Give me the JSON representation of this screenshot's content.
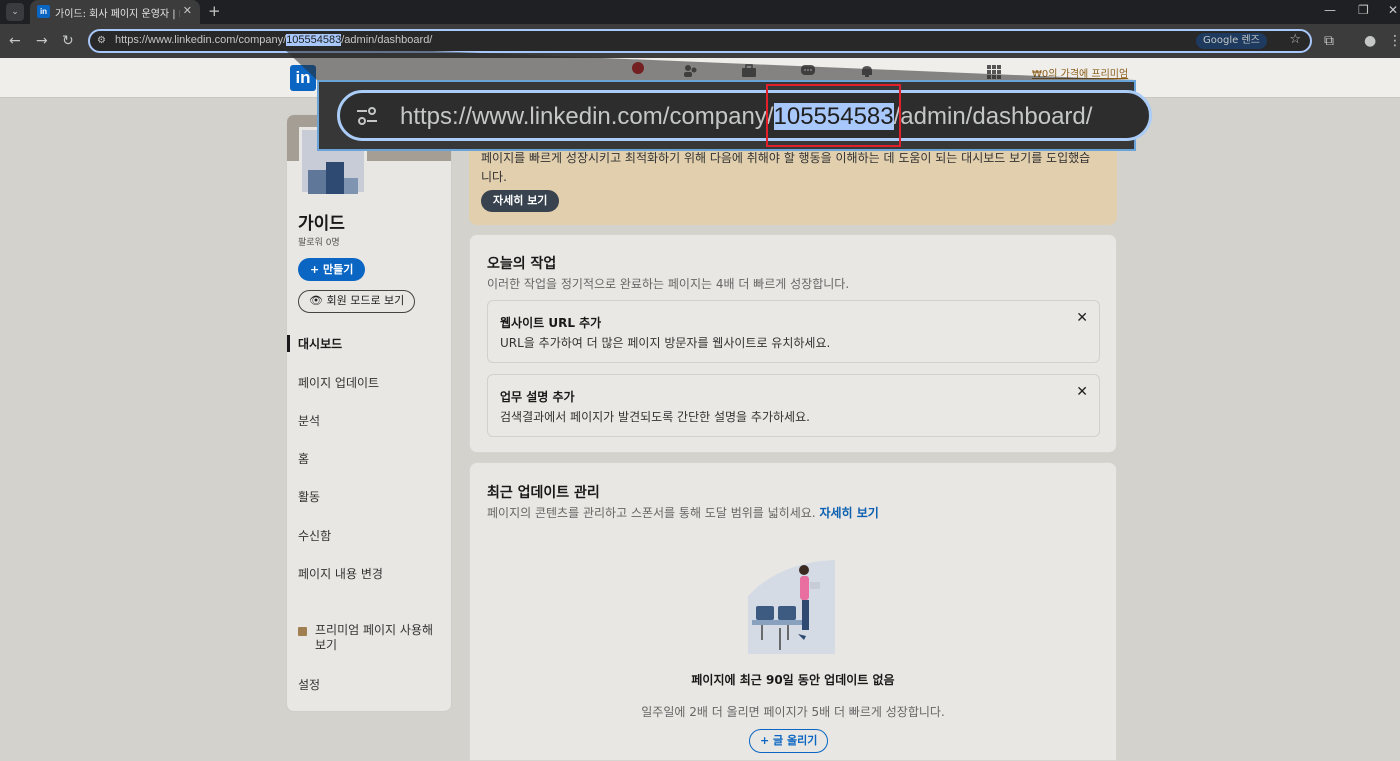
{
  "browser": {
    "tab_title": "가이드: 회사 페이지 운영자 | L",
    "tab_favicon": "in",
    "url_prefix": "https://www.linkedin.com/company/",
    "url_id": "105554583",
    "url_suffix": "/admin/dashboard/",
    "lens_label": "Google 렌즈"
  },
  "zoom": {
    "url_prefix": "https://www.linkedin.com/company/",
    "url_id": "105554583",
    "url_suffix": "/admin/dashboard/"
  },
  "header": {
    "logo": "in",
    "premium_link": "₩0의 가격에 프리미엄"
  },
  "sidebar": {
    "company_name": "가이드",
    "followers": "팔로워 0명",
    "create_button": "+ 만들기",
    "member_view_button": "회원 모드로 보기",
    "nav": [
      {
        "label": "대시보드"
      },
      {
        "label": "페이지 업데이트"
      },
      {
        "label": "분석"
      },
      {
        "label": "홈"
      },
      {
        "label": "활동"
      },
      {
        "label": "수신함"
      },
      {
        "label": "페이지 내용 변경"
      }
    ],
    "premium_item": "프리미엄 페이지 사용해 보기",
    "settings": "설정"
  },
  "banner": {
    "text": "페이지를 빠르게 성장시키고 최적화하기 위해 다음에 취해야 할 행동을 이해하는 데 도움이 되는 대시보드 보기를 도입했습니다.",
    "button": "자세히 보기"
  },
  "today": {
    "title": "오늘의 작업",
    "subtitle": "이러한 작업을 정기적으로 완료하는 페이지는 4배 더 빠르게 성장합니다.",
    "tasks": [
      {
        "title": "웹사이트 URL 추가",
        "desc": "URL을 추가하여 더 많은 페이지 방문자를 웹사이트로 유치하세요."
      },
      {
        "title": "업무 설명 추가",
        "desc": "검색결과에서 페이지가 발견되도록 간단한 설명을 추가하세요."
      }
    ]
  },
  "updates": {
    "title": "최근 업데이트 관리",
    "subtitle": "페이지의 콘텐츠를 관리하고 스폰서를 통해 도달 범위를 넓히세요.",
    "learn_more": "자세히 보기",
    "empty_title": "페이지에 최근 90일 동안 업데이트 없음",
    "empty_sub": "일주일에 2배 더 올리면 페이지가 5배 더 빠르게 성장합니다.",
    "post_button": "+ 글 올리기"
  },
  "colors": {
    "linkedin_blue": "#0a66c2",
    "highlight": "#a8c7fa",
    "callout_red": "#e0202a"
  }
}
